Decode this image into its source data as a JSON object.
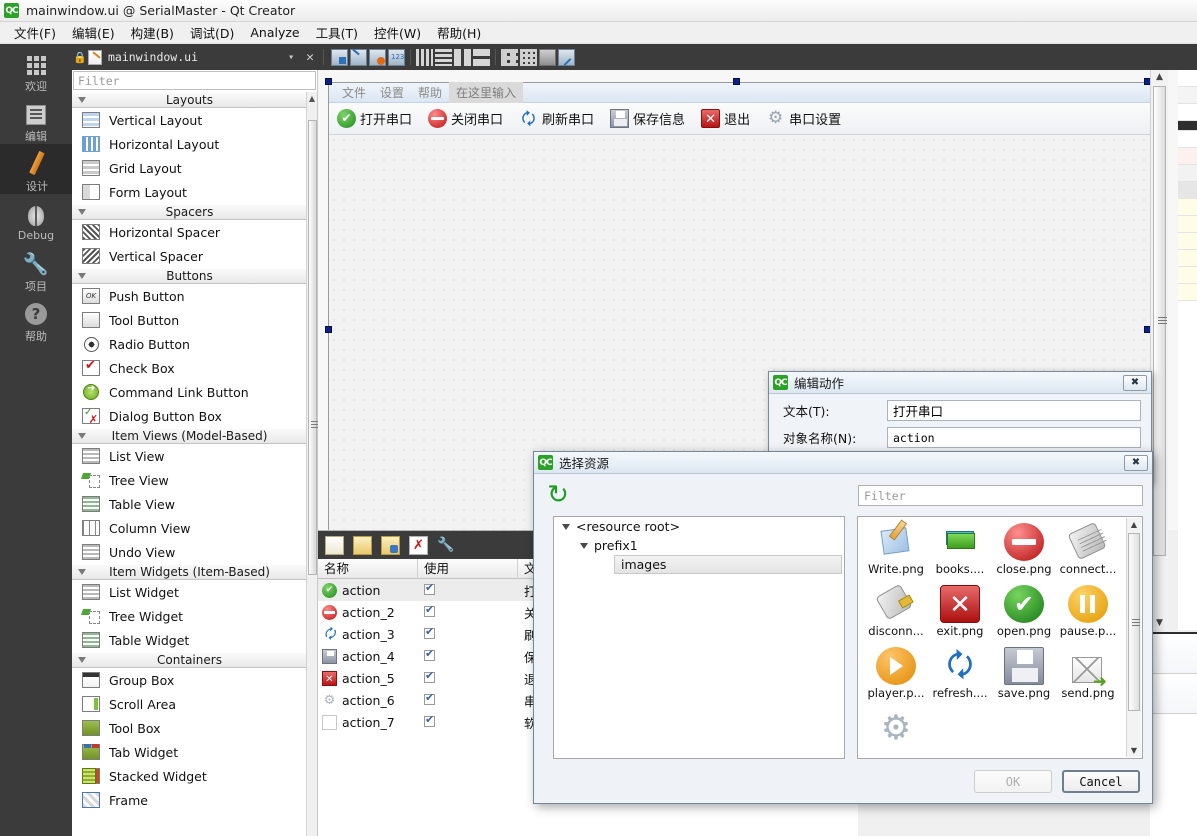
{
  "window": {
    "logo": "QC",
    "title": "mainwindow.ui @ SerialMaster - Qt Creator"
  },
  "menubar": {
    "items": [
      "文件(F)",
      "编辑(E)",
      "构建(B)",
      "调试(D)",
      "Analyze",
      "工具(T)",
      "控件(W)",
      "帮助(H)"
    ]
  },
  "modebar": {
    "items": [
      {
        "label": "欢迎",
        "icon": "grid-icon",
        "active": false
      },
      {
        "label": "编辑",
        "icon": "document-icon",
        "active": false
      },
      {
        "label": "设计",
        "icon": "pencil-icon",
        "active": true
      },
      {
        "label": "Debug",
        "icon": "bug-icon",
        "active": false
      },
      {
        "label": "项目",
        "icon": "wrench-icon",
        "active": false
      },
      {
        "label": "帮助",
        "icon": "question-icon",
        "active": false
      }
    ]
  },
  "editor_tab": {
    "filename": "mainwindow.ui",
    "lock_icon": "lock-icon",
    "dropdown_icon": "chevron-down-icon",
    "close_icon": "close-icon"
  },
  "designer_toolbar": {
    "buttons": [
      "edit-widgets-icon",
      "edit-signals-icon",
      "edit-buddies-icon",
      "edit-tab-order-icon",
      "layout-horizontal-icon",
      "layout-vertical-icon",
      "layout-splitter-h-icon",
      "layout-splitter-v-icon",
      "layout-form-icon",
      "layout-grid-icon",
      "break-layout-icon",
      "adjust-size-icon"
    ]
  },
  "widget_box": {
    "filter_placeholder": "Filter",
    "groups": [
      {
        "title": "Layouts",
        "items": [
          {
            "label": "Vertical Layout",
            "icon": "vertical-layout-icon"
          },
          {
            "label": "Horizontal Layout",
            "icon": "horizontal-layout-icon"
          },
          {
            "label": "Grid Layout",
            "icon": "grid-layout-icon"
          },
          {
            "label": "Form Layout",
            "icon": "form-layout-icon"
          }
        ]
      },
      {
        "title": "Spacers",
        "items": [
          {
            "label": "Horizontal Spacer",
            "icon": "horizontal-spacer-icon"
          },
          {
            "label": "Vertical Spacer",
            "icon": "vertical-spacer-icon"
          }
        ]
      },
      {
        "title": "Buttons",
        "items": [
          {
            "label": "Push Button",
            "icon": "push-button-icon"
          },
          {
            "label": "Tool Button",
            "icon": "tool-button-icon"
          },
          {
            "label": "Radio Button",
            "icon": "radio-button-icon"
          },
          {
            "label": "Check Box",
            "icon": "check-box-icon"
          },
          {
            "label": "Command Link Button",
            "icon": "command-link-icon"
          },
          {
            "label": "Dialog Button Box",
            "icon": "dialog-button-box-icon"
          }
        ]
      },
      {
        "title": "Item Views (Model-Based)",
        "items": [
          {
            "label": "List View",
            "icon": "list-view-icon"
          },
          {
            "label": "Tree View",
            "icon": "tree-view-icon"
          },
          {
            "label": "Table View",
            "icon": "table-view-icon"
          },
          {
            "label": "Column View",
            "icon": "column-view-icon"
          },
          {
            "label": "Undo View",
            "icon": "undo-view-icon"
          }
        ]
      },
      {
        "title": "Item Widgets (Item-Based)",
        "items": [
          {
            "label": "List Widget",
            "icon": "list-widget-icon"
          },
          {
            "label": "Tree Widget",
            "icon": "tree-widget-icon"
          },
          {
            "label": "Table Widget",
            "icon": "table-widget-icon"
          }
        ]
      },
      {
        "title": "Containers",
        "items": [
          {
            "label": "Group Box",
            "icon": "group-box-icon"
          },
          {
            "label": "Scroll Area",
            "icon": "scroll-area-icon"
          },
          {
            "label": "Tool Box",
            "icon": "tool-box-icon"
          },
          {
            "label": "Tab Widget",
            "icon": "tab-widget-icon"
          },
          {
            "label": "Stacked Widget",
            "icon": "stacked-widget-icon"
          },
          {
            "label": "Frame",
            "icon": "frame-icon"
          }
        ]
      }
    ]
  },
  "form": {
    "menu": [
      {
        "label": "文件",
        "placeholder": false
      },
      {
        "label": "设置",
        "placeholder": false
      },
      {
        "label": "帮助",
        "placeholder": false
      },
      {
        "label": "在这里输入",
        "placeholder": true
      }
    ],
    "toolbar": [
      {
        "label": "打开串口",
        "icon": "open-port-icon"
      },
      {
        "label": "关闭串口",
        "icon": "close-port-icon"
      },
      {
        "label": "刷新串口",
        "icon": "refresh-port-icon"
      },
      {
        "label": "保存信息",
        "icon": "save-icon"
      },
      {
        "label": "退出",
        "icon": "exit-icon"
      },
      {
        "label": "串口设置",
        "icon": "settings-gear-icon"
      }
    ]
  },
  "action_editor": {
    "toolbar": [
      "new-action-icon",
      "new-folder-icon",
      "edit-folder-icon",
      "delete-icon",
      "wrench-icon"
    ],
    "columns": [
      "名称",
      "使用",
      "文"
    ],
    "rows": [
      {
        "name": "action",
        "used": true,
        "text": "打",
        "icon": "open-port-icon",
        "selected": true
      },
      {
        "name": "action_2",
        "used": true,
        "text": "关",
        "icon": "close-port-icon",
        "selected": false
      },
      {
        "name": "action_3",
        "used": true,
        "text": "刷",
        "icon": "refresh-port-icon",
        "selected": false
      },
      {
        "name": "action_4",
        "used": true,
        "text": "保",
        "icon": "save-icon",
        "selected": false
      },
      {
        "name": "action_5",
        "used": true,
        "text": "退",
        "icon": "exit-icon",
        "selected": false
      },
      {
        "name": "action_6",
        "used": true,
        "text": "串",
        "icon": "settings-gear-icon",
        "selected": false
      },
      {
        "name": "action_7",
        "used": true,
        "text": "软",
        "icon": "blank-icon",
        "selected": false
      }
    ]
  },
  "edit_action_dialog": {
    "logo": "QC",
    "title": "编辑动作",
    "close_icon": "close-icon",
    "fields": [
      {
        "label": "文本(T):",
        "value": "打开串口"
      },
      {
        "label": "对象名称(N):",
        "value": "action"
      }
    ]
  },
  "resource_dialog": {
    "logo": "QC",
    "title": "选择资源",
    "close_icon": "close-icon",
    "reload_icon": "reload-icon",
    "filter_placeholder": "Filter",
    "tree": [
      {
        "label": "<resource root>",
        "depth": 0,
        "expanded": true,
        "selected": false
      },
      {
        "label": "prefix1",
        "depth": 1,
        "expanded": true,
        "selected": false
      },
      {
        "label": "images",
        "depth": 2,
        "expanded": false,
        "selected": true
      }
    ],
    "files": [
      {
        "name": "Write.png",
        "icon": "write-icon"
      },
      {
        "name": "books....",
        "icon": "books-icon"
      },
      {
        "name": "close.png",
        "icon": "close-port-icon"
      },
      {
        "name": "connect...",
        "icon": "connect-icon"
      },
      {
        "name": "disconn...",
        "icon": "disconnect-icon"
      },
      {
        "name": "exit.png",
        "icon": "exit-icon"
      },
      {
        "name": "open.png",
        "icon": "open-port-icon"
      },
      {
        "name": "pause.p...",
        "icon": "pause-icon"
      },
      {
        "name": "player.p...",
        "icon": "player-icon"
      },
      {
        "name": "refresh....",
        "icon": "refresh-port-icon"
      },
      {
        "name": "save.png",
        "icon": "save-icon"
      },
      {
        "name": "send.png",
        "icon": "send-icon"
      },
      {
        "name": "",
        "icon": "settings-gear-icon"
      }
    ],
    "buttons": [
      {
        "label": "OK",
        "enabled": false,
        "default": false
      },
      {
        "label": "Cancel",
        "enabled": true,
        "default": true
      }
    ]
  },
  "colors": {
    "mode_bar_bg": "#3b3b3b",
    "mode_active_bg": "#2b2b2b",
    "accent_green": "#2aa226",
    "accent_orange": "#e08020",
    "selection_blue": "#0b1f8f",
    "dialog_bg": "#eff3f7"
  }
}
